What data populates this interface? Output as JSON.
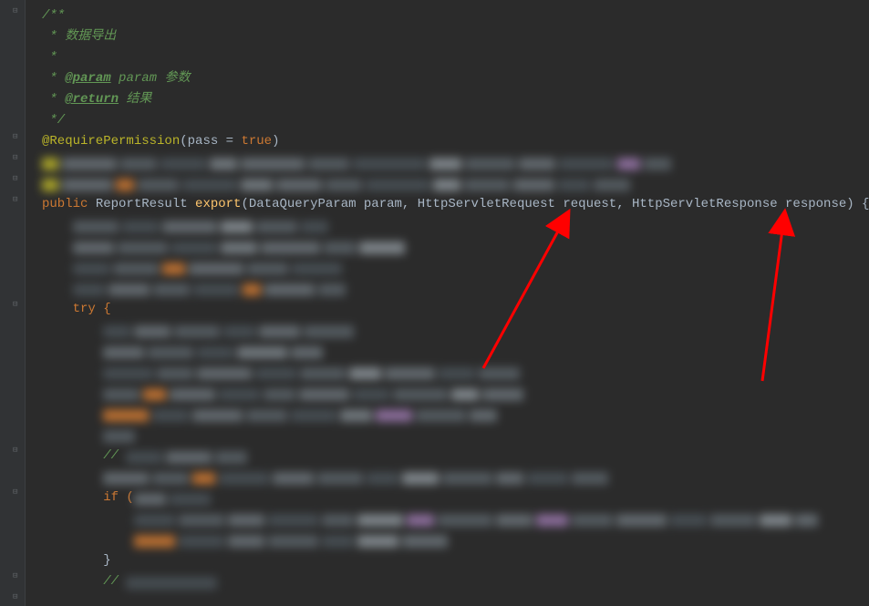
{
  "comment": {
    "start": "/**",
    "line1": " * 数据导出",
    "line2": " *",
    "line3_prefix": " * ",
    "param_tag": "@param",
    "param_text": " param 参数",
    "line4_prefix": " * ",
    "return_tag": "@return",
    "return_text": " 结果",
    "end": " */"
  },
  "annotation": {
    "name": "@RequirePermission",
    "args_open": "(",
    "args_key": "pass",
    "args_eq": " = ",
    "args_val": "true",
    "args_close": ")"
  },
  "method": {
    "modifier": "public",
    "return_type": " ReportResult ",
    "name": "export",
    "params_open": "(",
    "param1_type": "DataQueryParam ",
    "param1_name": "param",
    "sep1": ", ",
    "param2_type": "HttpServletRequest ",
    "param2_name": "request",
    "sep2": ", ",
    "param3_type": "HttpServletResponse ",
    "param3_name": "response",
    "params_close": ") {"
  },
  "try_line": "try {",
  "if_prefix": "if (",
  "close_brace": "}",
  "comment_slash": "// "
}
